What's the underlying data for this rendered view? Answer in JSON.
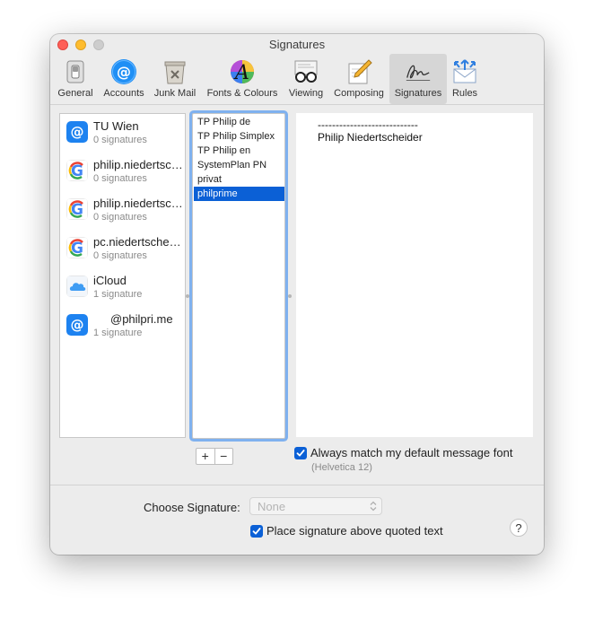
{
  "window": {
    "title": "Signatures"
  },
  "toolbar": {
    "items": [
      {
        "label": "General",
        "icon": "general-switch-icon"
      },
      {
        "label": "Accounts",
        "icon": "accounts-at-icon"
      },
      {
        "label": "Junk Mail",
        "icon": "junk-mail-bin-icon"
      },
      {
        "label": "Fonts & Colours",
        "icon": "fonts-colours-icon"
      },
      {
        "label": "Viewing",
        "icon": "viewing-glasses-icon"
      },
      {
        "label": "Composing",
        "icon": "composing-pencil-icon"
      },
      {
        "label": "Signatures",
        "icon": "signature-icon"
      },
      {
        "label": "Rules",
        "icon": "rules-envelope-icon"
      }
    ],
    "active": "Signatures"
  },
  "accounts": [
    {
      "name": "TU Wien",
      "subtitle": "0 signatures",
      "icon": "at-mail-icon"
    },
    {
      "name": "philip.niedertscheider",
      "subtitle": "0 signatures",
      "icon": "google-icon"
    },
    {
      "name": "philip.niedertscheider",
      "subtitle": "0 signatures",
      "icon": "google-icon"
    },
    {
      "name": "pc.niedertscheider",
      "subtitle": "0 signatures",
      "icon": "google-icon"
    },
    {
      "name": "iCloud",
      "subtitle": "1 signature",
      "icon": "icloud-icon"
    },
    {
      "name": "@philpri.me",
      "subtitle": "1 signature",
      "icon": "at-mail-icon"
    }
  ],
  "signatures": [
    {
      "label": "TP Philip de"
    },
    {
      "label": "TP Philip Simplex"
    },
    {
      "label": "TP Philip en"
    },
    {
      "label": "SystemPlan PN"
    },
    {
      "label": "privat"
    },
    {
      "label": "philprime"
    }
  ],
  "selected_signature": "philprime",
  "preview": {
    "separator": "----------------------------",
    "name": "Philip Niedertscheider"
  },
  "buttons": {
    "add": "+",
    "remove": "−"
  },
  "match_font": {
    "label": "Always match my default message font",
    "sub": "(Helvetica 12)",
    "checked": true
  },
  "choose_signature": {
    "label": "Choose Signature:",
    "value": "None"
  },
  "place_above": {
    "label": "Place signature above quoted text",
    "checked": true
  },
  "help": {
    "label": "?"
  },
  "colors": {
    "accent": "#0b60d6",
    "focus_ring": "#7fb1ef",
    "window_bg": "#ececec"
  }
}
